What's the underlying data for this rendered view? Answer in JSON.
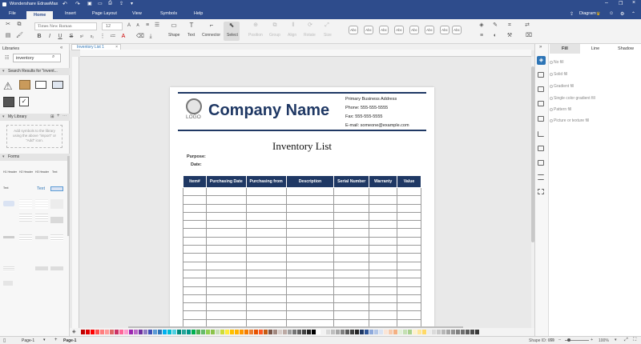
{
  "app": {
    "title": "Wondershare EdrawMax"
  },
  "menu": {
    "items": [
      "File",
      "Home",
      "Insert",
      "Page Layout",
      "View",
      "Symbols",
      "Help"
    ],
    "active": "Home",
    "diagram_label": "Diagram"
  },
  "ribbon": {
    "font": "Times New Roman",
    "font_size": "12",
    "tools": [
      "Shape",
      "Text",
      "Connector",
      "Select"
    ],
    "disabled_tools": [
      "Position",
      "Group",
      "Align",
      "Rotate",
      "Size"
    ],
    "style_labels": [
      "Abc",
      "Abc",
      "Abc",
      "Abc",
      "Abc",
      "Abc",
      "Abc",
      "Abc",
      "Abc",
      "Abc"
    ]
  },
  "left_panel": {
    "title": "Libraries",
    "search_value": "inventory",
    "search_results_label": "Search Results for \"invent...",
    "my_library_label": "My Library",
    "my_library_hint": "Add symbols to the library using the above \"import\" or \"Add\" icon.",
    "forms_label": "Forms",
    "form_thumbs": [
      "H1 Header",
      "H2 Header",
      "H3 Header",
      "Text",
      "Text",
      "Text"
    ]
  },
  "doc_tab": {
    "label": "Inventory List 1"
  },
  "document": {
    "company": "Company Name",
    "logo_text": "LOGO",
    "address": "Primary Business Address",
    "phone": "Phone: 555-555-5555",
    "fax": "Fax: 555-555-5555",
    "email": "E-mail: someone@example.com",
    "title": "Inventory List",
    "purpose_label": "Purpose:",
    "date_label": "Date:",
    "columns": [
      "Item#",
      "Purchasing Date",
      "Purchasing from",
      "Description",
      "Serial Number",
      "Warranty",
      "Value"
    ],
    "row_count": 17
  },
  "right_panel": {
    "tabs": [
      "Fill",
      "Line",
      "Shadow"
    ],
    "active_tab": "Fill",
    "options": [
      "No fill",
      "Solid fill",
      "Gradient fill",
      "Single color gradient fill",
      "Pattern fill",
      "Picture or texture fill"
    ]
  },
  "status": {
    "page_tab": "Page-1",
    "page_active": "Page-1",
    "shape_id": "Shape ID: 659",
    "zoom": "100%"
  },
  "palette_colors": [
    "#c00000",
    "#e00000",
    "#ff0000",
    "#ff4f4f",
    "#ff7f7f",
    "#ff9999",
    "#e06666",
    "#cc3366",
    "#ff6699",
    "#ff99cc",
    "#9c27b0",
    "#ba68c8",
    "#7030a0",
    "#8e7cc3",
    "#3f51b5",
    "#5b9bd5",
    "#2e75b6",
    "#00b0f0",
    "#00bcd4",
    "#4dd0e1",
    "#00897b",
    "#26a69a",
    "#009688",
    "#00b050",
    "#4caf50",
    "#66bb6a",
    "#92d050",
    "#8bc34a",
    "#c6e0b4",
    "#cddc39",
    "#ffeb3b",
    "#ffc000",
    "#ffb300",
    "#ff9800",
    "#f57c00",
    "#ed7d31",
    "#e65100",
    "#ff5722",
    "#c55a11",
    "#795548",
    "#a1887f",
    "#d7ccc8",
    "#bcaaa4",
    "#9e9e9e",
    "#757575",
    "#616161",
    "#424242",
    "#212121",
    "#000000",
    "#ffffff",
    "#f2f2f2",
    "#d9d9d9",
    "#bfbfbf",
    "#a6a6a6",
    "#808080",
    "#595959",
    "#404040",
    "#262626",
    "#1f3864",
    "#2f5597",
    "#8faadc",
    "#b4c7e7",
    "#dae3f3",
    "#fbe5d6",
    "#f8cbad",
    "#f4b183",
    "#e2f0d9",
    "#c5e0b4",
    "#a9d18e",
    "#fff2cc",
    "#ffe699",
    "#ffd966",
    "#ededed",
    "#dbdbdb",
    "#c9c9c9",
    "#b7b7b7",
    "#a5a5a5",
    "#939393",
    "#818181",
    "#6f6f6f",
    "#5d5d5d",
    "#4b4b4b",
    "#393939"
  ]
}
